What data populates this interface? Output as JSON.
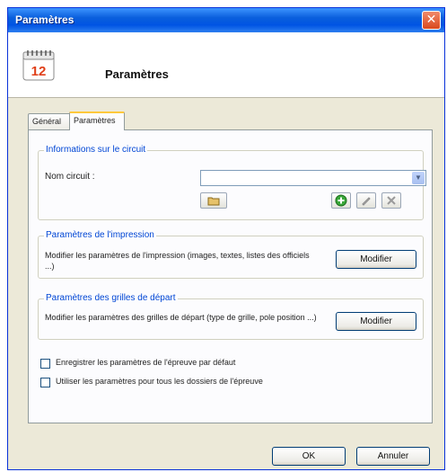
{
  "window": {
    "title": "Paramètres"
  },
  "header": {
    "title": "Paramètres",
    "icon": "calendar-icon",
    "calendar_day": "12"
  },
  "tabs": [
    {
      "label": "Général"
    },
    {
      "label": "Paramètres"
    }
  ],
  "circuit": {
    "legend": "Informations sur le circuit",
    "name_label": "Nom circuit :",
    "name_value": ""
  },
  "impression": {
    "legend": "Paramètres de l'impression",
    "description": "Modifier les paramètres de l'impression (images, textes, listes des officiels ...)",
    "button": "Modifier"
  },
  "grilles": {
    "legend": "Paramètres des grilles de départ",
    "description": "Modifier les paramètres des grilles de départ (type de grille, pole position ...)",
    "button": "Modifier"
  },
  "checkboxes": [
    {
      "label": "Enregistrer les paramètres de l'épreuve par défaut",
      "checked": false
    },
    {
      "label": "Utiliser les paramètres pour tous les dossiers de l'épreuve",
      "checked": false
    }
  ],
  "footer": {
    "ok": "OK",
    "cancel": "Annuler"
  }
}
